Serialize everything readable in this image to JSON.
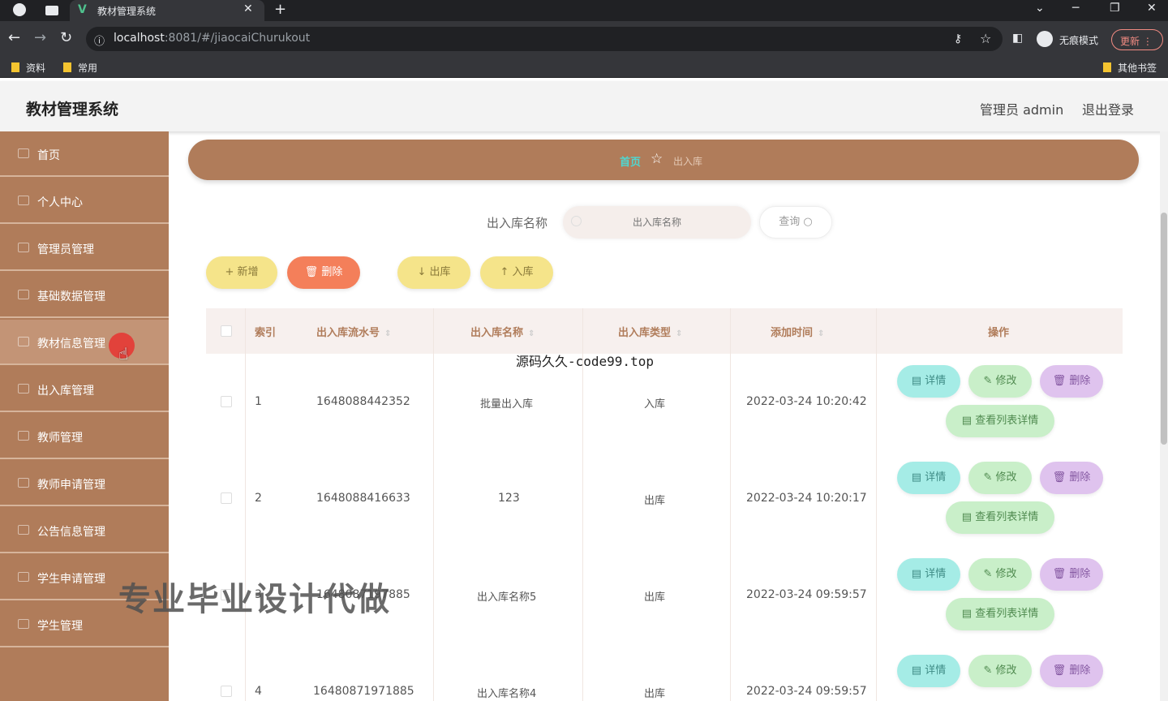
{
  "browser": {
    "tab_title": "教材管理系统",
    "url_host": "localhost",
    "url_rest": ":8081/#/jiaocaiChurukout",
    "incognito_label": "无痕模式",
    "update_label": "更新",
    "bookmarks": [
      "资料",
      "常用"
    ],
    "other_bookmarks": "其他书签"
  },
  "header": {
    "title": "教材管理系统",
    "user": "管理员 admin",
    "logout": "退出登录"
  },
  "sidebar": {
    "items": [
      {
        "label": "首页"
      },
      {
        "label": "个人中心"
      },
      {
        "label": "管理员管理"
      },
      {
        "label": "基础数据管理"
      },
      {
        "label": "教材信息管理"
      },
      {
        "label": "出入库管理"
      },
      {
        "label": "教师管理"
      },
      {
        "label": "教师申请管理"
      },
      {
        "label": "公告信息管理"
      },
      {
        "label": "学生申请管理"
      },
      {
        "label": "学生管理"
      }
    ]
  },
  "breadcrumb": {
    "home": "首页",
    "current": "出入库"
  },
  "search": {
    "label": "出入库名称",
    "placeholder": "出入库名称",
    "query_button": "查询"
  },
  "actions": {
    "add": "+ 新增",
    "delete": "删除",
    "out": "出库",
    "in": "入库"
  },
  "table": {
    "headers": [
      "索引",
      "出入库流水号",
      "出入库名称",
      "出入库类型",
      "添加时间",
      "操作"
    ],
    "buttons": {
      "detail": "详情",
      "edit": "修改",
      "delete": "删除",
      "list_detail": "查看列表详情"
    },
    "rows": [
      {
        "index": "1",
        "serial": "1648088442352",
        "name": "批量出入库",
        "type": "入库",
        "time": "2022-03-24 10:20:42"
      },
      {
        "index": "2",
        "serial": "1648088416633",
        "name": "123",
        "type": "出库",
        "time": "2022-03-24 10:20:17"
      },
      {
        "index": "3",
        "serial": "1648087197885",
        "name": "出入库名称5",
        "type": "出库",
        "time": "2022-03-24 09:59:57"
      },
      {
        "index": "4",
        "serial": "16480871971885",
        "name": "出入库名称4",
        "type": "出库",
        "time": "2022-03-24 09:59:57"
      }
    ]
  },
  "watermarks": {
    "center_text": "源码久久-code99.top",
    "big_text": "专业毕业设计代做"
  }
}
